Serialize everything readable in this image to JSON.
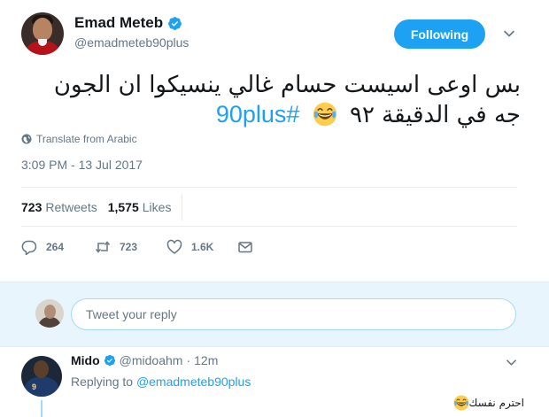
{
  "tweet": {
    "display_name": "Emad Meteb",
    "handle": "@emadmeteb90plus",
    "follow_label": "Following",
    "text": "بس اوعى اسيست حسام غالي ينسيكوا ان الجون جه في الدقيقة ٩٢",
    "hashtag": "#90plus",
    "translate_label": "Translate from Arabic",
    "timestamp": "3:09 PM - 13 Jul 2017",
    "stats": {
      "retweets_count": "723",
      "retweets_label": "Retweets",
      "likes_count": "1,575",
      "likes_label": "Likes"
    },
    "actions": {
      "reply_count": "264",
      "retweet_count": "723",
      "like_count": "1.6K"
    }
  },
  "reply_box": {
    "placeholder": "Tweet your reply"
  },
  "reply": {
    "display_name": "Mido",
    "handle": "@midoahm",
    "separator": "·",
    "time": "12m",
    "replying_prefix": "Replying to",
    "replying_to": "@emadmeteb90plus",
    "text": "احترم نفسك"
  },
  "icons": {
    "verified": "verified-badge-icon",
    "emoji": "face-with-tears-of-joy",
    "translate": "globe-icon",
    "reply": "reply-icon",
    "retweet": "retweet-icon",
    "like": "heart-icon",
    "dm": "envelope-icon",
    "menu": "chevron-down-icon"
  },
  "colors": {
    "accent": "#1da1f2",
    "text": "#14171a",
    "secondary_text": "#657786",
    "reply_bg": "#e8f5fd"
  }
}
